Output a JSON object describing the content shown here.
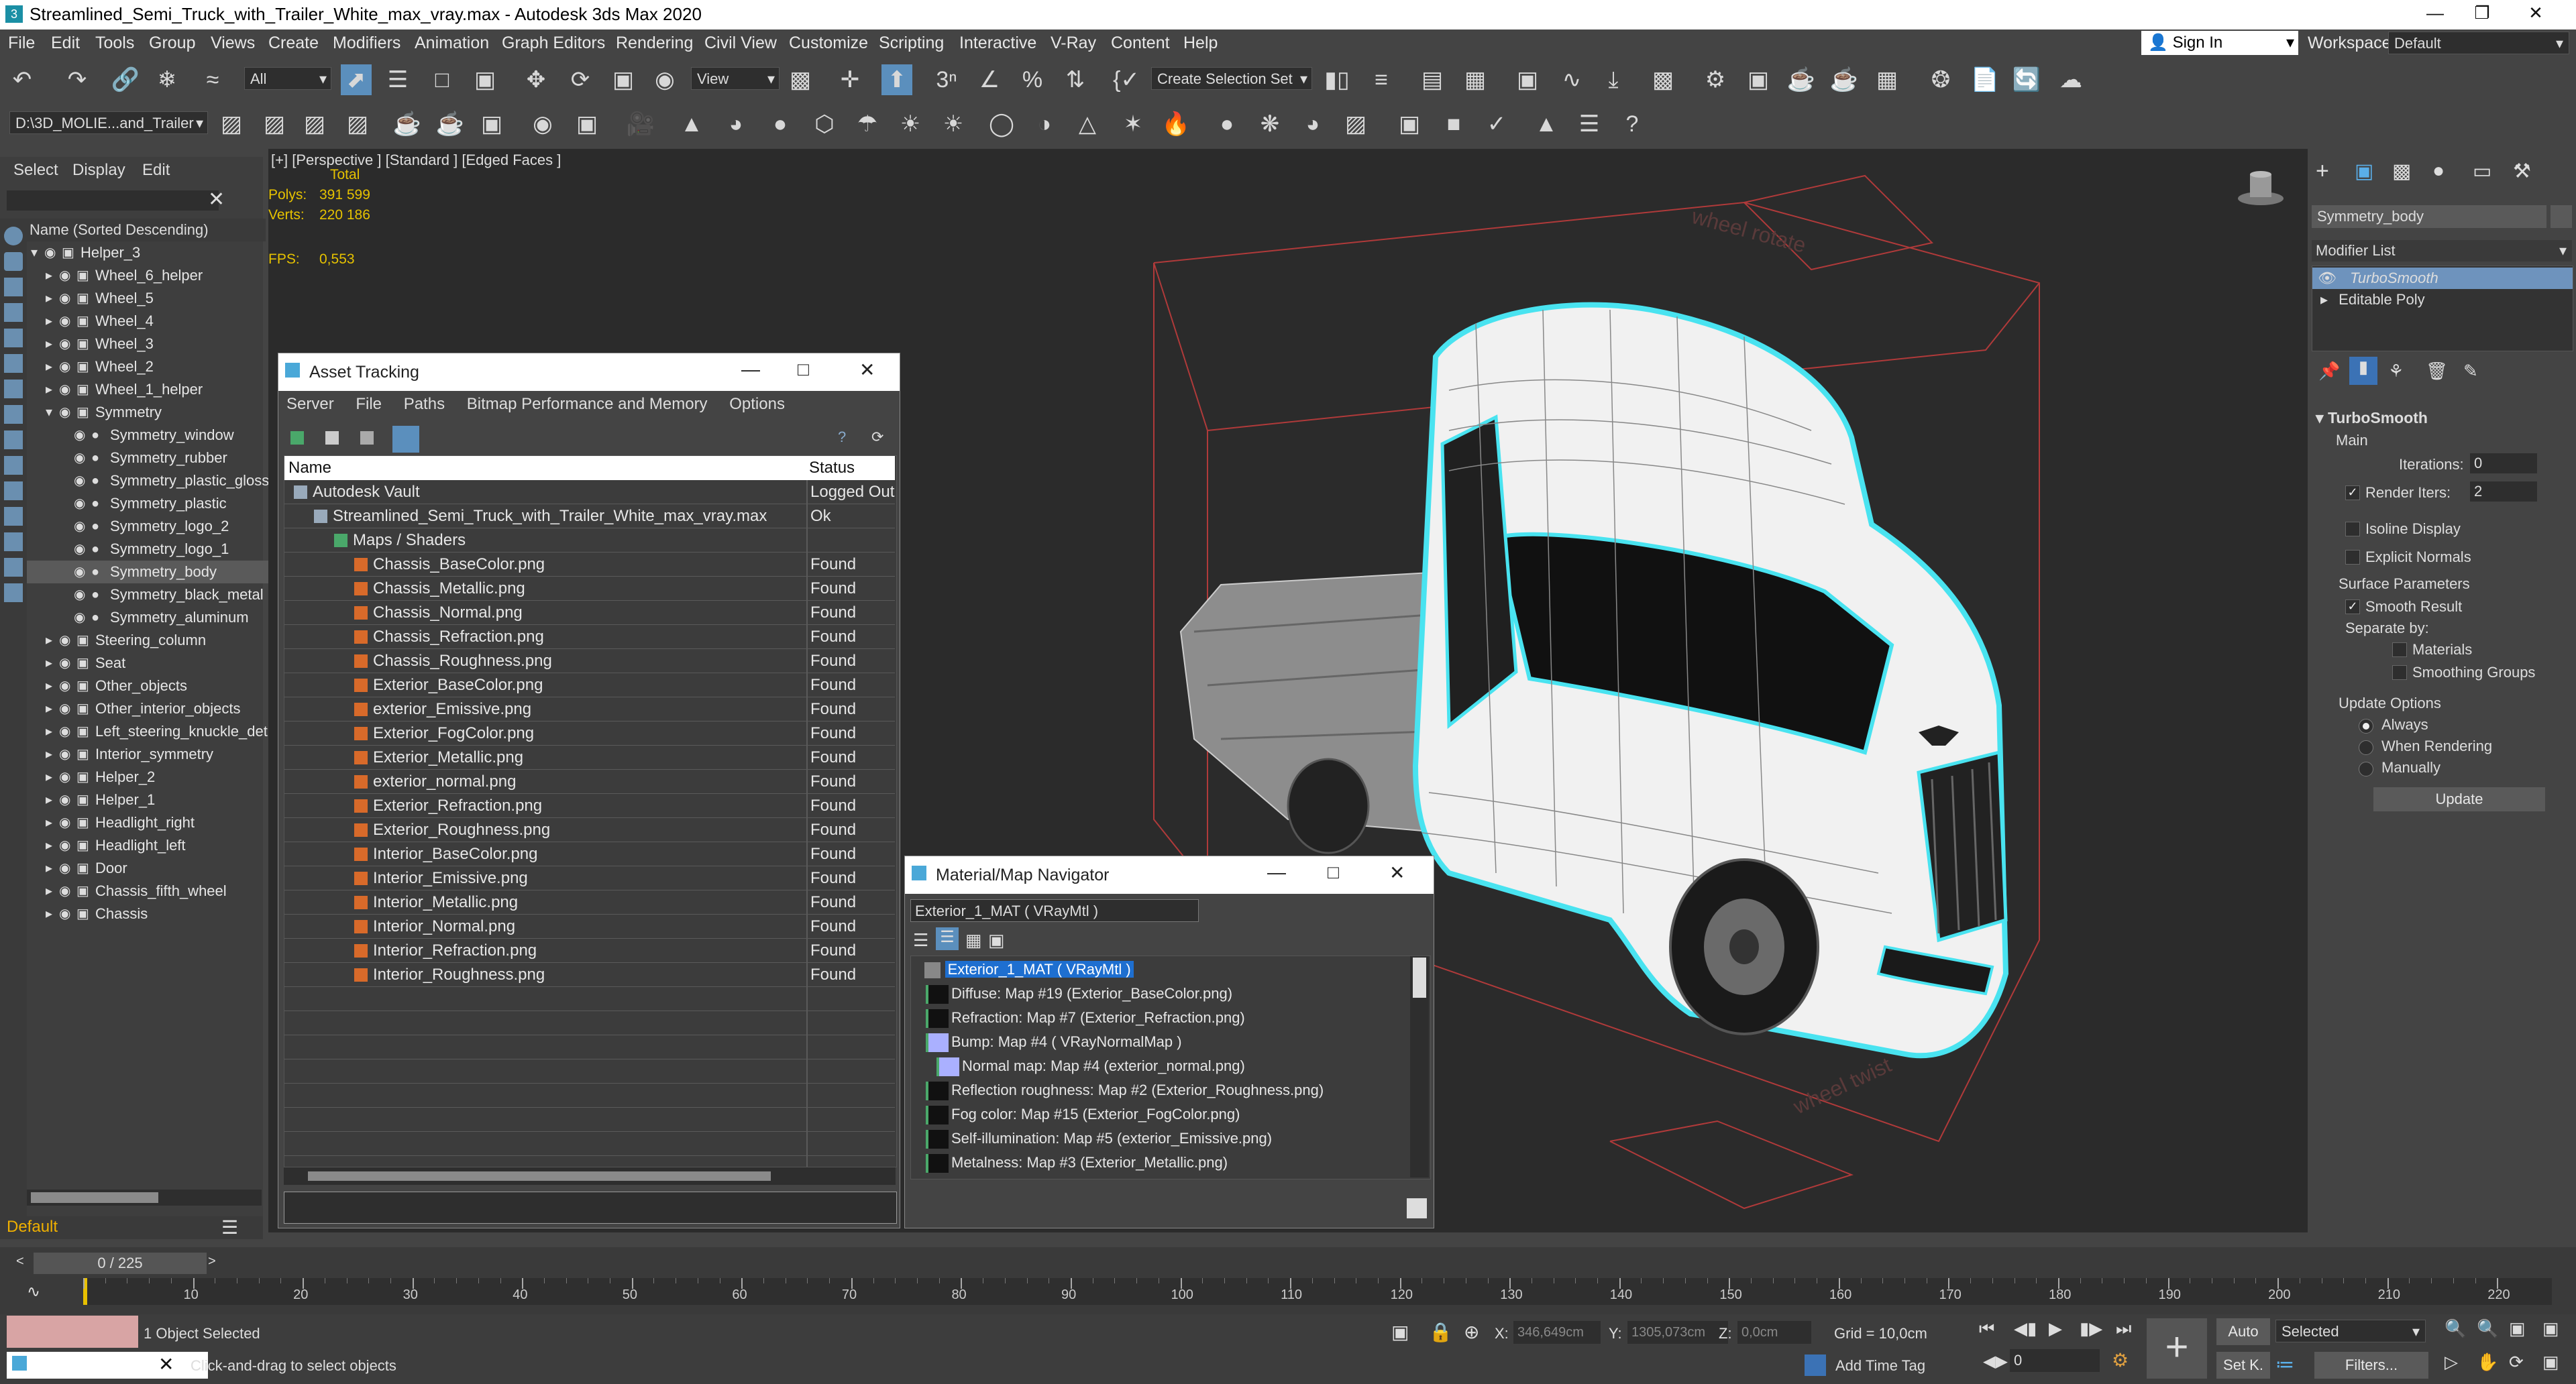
{
  "window": {
    "title": "Streamlined_Semi_Truck_with_Trailer_White_max_vray.max - Autodesk 3ds Max 2020",
    "app_icon": "3"
  },
  "menu": [
    "File",
    "Edit",
    "Tools",
    "Group",
    "Views",
    "Create",
    "Modifiers",
    "Animation",
    "Graph Editors",
    "Rendering",
    "Civil View",
    "Customize",
    "Scripting",
    "Interactive",
    "V-Ray",
    "Content",
    "Help"
  ],
  "account": {
    "sign_in": "Sign In",
    "workspaces_label": "Workspaces:",
    "workspace_value": "Default"
  },
  "toolbar": {
    "filter_value": "All",
    "view_value": "View",
    "selection_set_value": "Create Selection Set",
    "path_value": "D:\\3D_MOLIE...and_Trailer"
  },
  "explorer": {
    "tabs": [
      "Select",
      "Display",
      "Edit"
    ],
    "header": "Name (Sorted Descending)",
    "items": [
      {
        "name": "Helper_3",
        "indent": 0,
        "selected": false
      },
      {
        "name": "Wheel_6_helper",
        "indent": 1,
        "selected": false
      },
      {
        "name": "Wheel_5",
        "indent": 1,
        "selected": false
      },
      {
        "name": "Wheel_4",
        "indent": 1,
        "selected": false
      },
      {
        "name": "Wheel_3",
        "indent": 1,
        "selected": false
      },
      {
        "name": "Wheel_2",
        "indent": 1,
        "selected": false
      },
      {
        "name": "Wheel_1_helper",
        "indent": 1,
        "selected": false
      },
      {
        "name": "Symmetry",
        "indent": 1,
        "selected": false
      },
      {
        "name": "Symmetry_window",
        "indent": 2,
        "selected": false
      },
      {
        "name": "Symmetry_rubber",
        "indent": 2,
        "selected": false
      },
      {
        "name": "Symmetry_plastic_gloss",
        "indent": 2,
        "selected": false
      },
      {
        "name": "Symmetry_plastic",
        "indent": 2,
        "selected": false
      },
      {
        "name": "Symmetry_logo_2",
        "indent": 2,
        "selected": false
      },
      {
        "name": "Symmetry_logo_1",
        "indent": 2,
        "selected": false
      },
      {
        "name": "Symmetry_body",
        "indent": 2,
        "selected": true
      },
      {
        "name": "Symmetry_black_metal",
        "indent": 2,
        "selected": false
      },
      {
        "name": "Symmetry_aluminum",
        "indent": 2,
        "selected": false
      },
      {
        "name": "Steering_column",
        "indent": 1,
        "selected": false
      },
      {
        "name": "Seat",
        "indent": 1,
        "selected": false
      },
      {
        "name": "Other_objects",
        "indent": 1,
        "selected": false
      },
      {
        "name": "Other_interior_objects",
        "indent": 1,
        "selected": false
      },
      {
        "name": "Left_steering_knuckle_det",
        "indent": 1,
        "selected": false
      },
      {
        "name": "Interior_symmetry",
        "indent": 1,
        "selected": false
      },
      {
        "name": "Helper_2",
        "indent": 1,
        "selected": false
      },
      {
        "name": "Helper_1",
        "indent": 1,
        "selected": false
      },
      {
        "name": "Headlight_right",
        "indent": 1,
        "selected": false
      },
      {
        "name": "Headlight_left",
        "indent": 1,
        "selected": false
      },
      {
        "name": "Door",
        "indent": 1,
        "selected": false
      },
      {
        "name": "Chassis_fifth_wheel",
        "indent": 1,
        "selected": false
      },
      {
        "name": "Chassis",
        "indent": 1,
        "selected": false
      }
    ],
    "layer": "Default"
  },
  "viewport": {
    "label_plus": "[+]",
    "label_view": "[Perspective ]",
    "label_shading": "[Standard ]",
    "label_faces": "[Edged Faces ]",
    "stats": {
      "total_label": "Total",
      "polys_label": "Polys:",
      "polys": "391 599",
      "verts_label": "Verts:",
      "verts": "220 186",
      "fps_label": "FPS:",
      "fps": "0,553"
    },
    "decal_top": "wheel rotate",
    "decal_bottom": "wheel twist"
  },
  "asset_tracking": {
    "title": "Asset Tracking",
    "menu": [
      "Server",
      "File",
      "Paths",
      "Bitmap Performance and Memory",
      "Options"
    ],
    "col_name": "Name",
    "col_status": "Status",
    "rows": [
      {
        "name": "Autodesk Vault",
        "status": "Logged Out",
        "level": 0
      },
      {
        "name": "Streamlined_Semi_Truck_with_Trailer_White_max_vray.max",
        "status": "Ok",
        "level": 1
      },
      {
        "name": "Maps / Shaders",
        "status": "",
        "level": 2
      },
      {
        "name": "Chassis_BaseColor.png",
        "status": "Found",
        "level": 3
      },
      {
        "name": "Chassis_Metallic.png",
        "status": "Found",
        "level": 3
      },
      {
        "name": "Chassis_Normal.png",
        "status": "Found",
        "level": 3
      },
      {
        "name": "Chassis_Refraction.png",
        "status": "Found",
        "level": 3
      },
      {
        "name": "Chassis_Roughness.png",
        "status": "Found",
        "level": 3
      },
      {
        "name": "Exterior_BaseColor.png",
        "status": "Found",
        "level": 3
      },
      {
        "name": "exterior_Emissive.png",
        "status": "Found",
        "level": 3
      },
      {
        "name": "Exterior_FogColor.png",
        "status": "Found",
        "level": 3
      },
      {
        "name": "Exterior_Metallic.png",
        "status": "Found",
        "level": 3
      },
      {
        "name": "exterior_normal.png",
        "status": "Found",
        "level": 3
      },
      {
        "name": "Exterior_Refraction.png",
        "status": "Found",
        "level": 3
      },
      {
        "name": "Exterior_Roughness.png",
        "status": "Found",
        "level": 3
      },
      {
        "name": "Interior_BaseColor.png",
        "status": "Found",
        "level": 3
      },
      {
        "name": "Interior_Emissive.png",
        "status": "Found",
        "level": 3
      },
      {
        "name": "Interior_Metallic.png",
        "status": "Found",
        "level": 3
      },
      {
        "name": "Interior_Normal.png",
        "status": "Found",
        "level": 3
      },
      {
        "name": "Interior_Refraction.png",
        "status": "Found",
        "level": 3
      },
      {
        "name": "Interior_Roughness.png",
        "status": "Found",
        "level": 3
      }
    ]
  },
  "material_nav": {
    "title": "Material/Map Navigator",
    "field": "Exterior_1_MAT  ( VRayMtl )",
    "root": "Exterior_1_MAT  ( VRayMtl )",
    "rows": [
      {
        "text": "Diffuse: Map #19 (Exterior_BaseColor.png)",
        "level": 1
      },
      {
        "text": "Refraction: Map #7 (Exterior_Refraction.png)",
        "level": 1
      },
      {
        "text": "Bump: Map #4  ( VRayNormalMap )",
        "level": 1
      },
      {
        "text": "Normal map: Map #4 (exterior_normal.png)",
        "level": 2
      },
      {
        "text": "Reflection roughness: Map #2 (Exterior_Roughness.png)",
        "level": 1
      },
      {
        "text": "Fog color: Map #15 (Exterior_FogColor.png)",
        "level": 1
      },
      {
        "text": "Self-illumination: Map #5 (exterior_Emissive.png)",
        "level": 1
      },
      {
        "text": "Metalness: Map #3 (Exterior_Metallic.png)",
        "level": 1
      }
    ]
  },
  "modify_panel": {
    "object_name": "Symmetry_body",
    "modifier_list": "Modifier List",
    "stack": [
      "TurboSmooth",
      "Editable Poly"
    ],
    "rollout_title": "TurboSmooth",
    "main_label": "Main",
    "iterations_label": "Iterations:",
    "iterations": "0",
    "render_iters_label": "Render Iters:",
    "render_iters": "2",
    "isoline": "Isoline Display",
    "explicit": "Explicit Normals",
    "surface_params": "Surface Parameters",
    "smooth_result": "Smooth Result",
    "separate_by": "Separate by:",
    "materials": "Materials",
    "smoothing_groups": "Smoothing Groups",
    "update_options": "Update Options",
    "always": "Always",
    "when_rendering": "When Rendering",
    "manually": "Manually",
    "update_btn": "Update"
  },
  "timeline": {
    "frame": "0 / 225",
    "ticks": [
      "0",
      "10",
      "20",
      "30",
      "40",
      "50",
      "60",
      "70",
      "80",
      "90",
      "100",
      "110",
      "120",
      "130",
      "140",
      "150",
      "160",
      "170",
      "180",
      "190",
      "200",
      "210",
      "220"
    ]
  },
  "status": {
    "selected": "1 Object Selected",
    "prompt": "Click-and-drag to select objects",
    "x_label": "X:",
    "x": "346,649cm",
    "y_label": "Y:",
    "y": "1305,073cm",
    "z_label": "Z:",
    "z": "0,0cm",
    "grid": "Grid = 10,0cm",
    "add_time_tag": "Add Time Tag",
    "auto": "Auto",
    "selected_combo": "Selected",
    "set_k": "Set K.",
    "filters": "Filters...",
    "frame_field": "0"
  }
}
